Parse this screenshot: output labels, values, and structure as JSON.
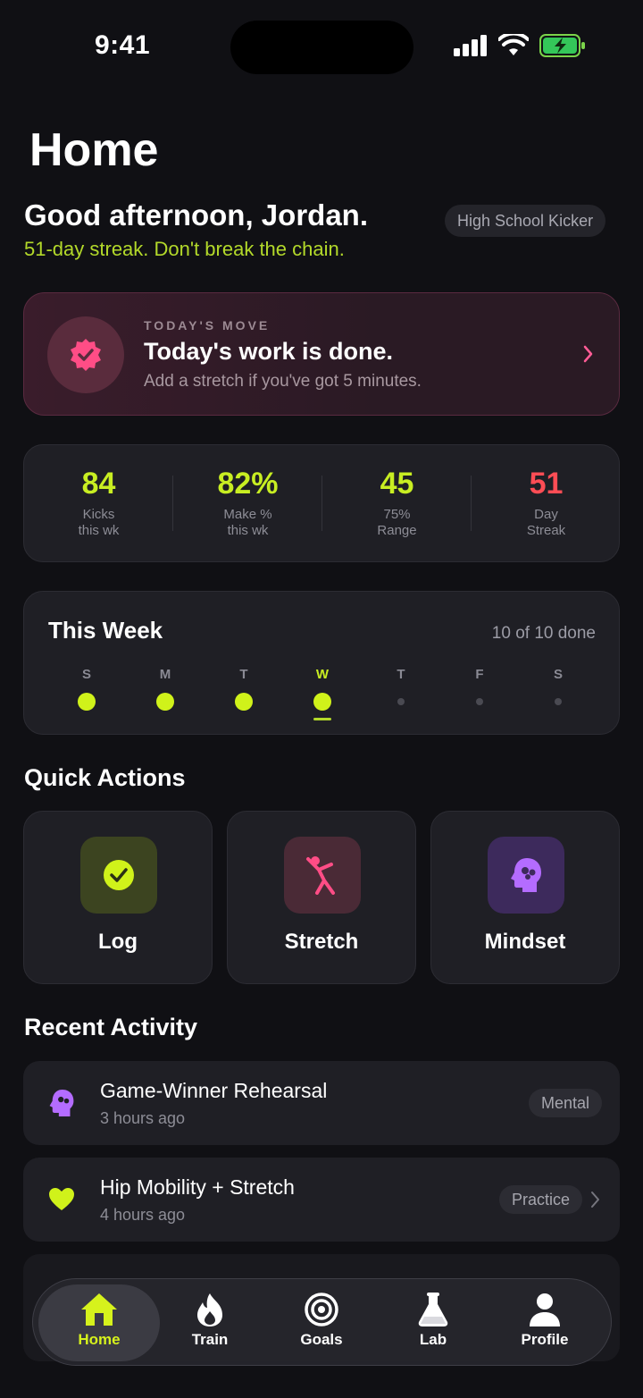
{
  "status_bar": {
    "time": "9:41"
  },
  "page": {
    "title": "Home"
  },
  "greeting": {
    "headline": "Good afternoon, Jordan.",
    "streak_text": "51-day streak. Don't break the chain.",
    "role": "High School Kicker"
  },
  "todays_move": {
    "kicker": "TODAY'S MOVE",
    "title": "Today's work is done.",
    "subtitle": "Add a stretch if you've got 5 minutes."
  },
  "stats": [
    {
      "value": "84",
      "label_1": "Kicks",
      "label_2": "this wk",
      "color": "#c8ee22"
    },
    {
      "value": "82%",
      "label_1": "Make %",
      "label_2": "this wk",
      "color": "#c8ee22"
    },
    {
      "value": "45",
      "label_1": "75%",
      "label_2": "Range",
      "color": "#c8ee22"
    },
    {
      "value": "51",
      "label_1": "Day",
      "label_2": "Streak",
      "color": "#ff4d55"
    }
  ],
  "week": {
    "title": "This Week",
    "count": "10 of 10 done",
    "days": [
      {
        "letter": "S",
        "done": true
      },
      {
        "letter": "M",
        "done": true
      },
      {
        "letter": "T",
        "done": true
      },
      {
        "letter": "W",
        "done": true,
        "today": true
      },
      {
        "letter": "T",
        "done": false
      },
      {
        "letter": "F",
        "done": false
      },
      {
        "letter": "S",
        "done": false
      }
    ]
  },
  "quick_actions": {
    "title": "Quick Actions",
    "items": [
      {
        "label": "Log",
        "icon": "check-circle-icon"
      },
      {
        "label": "Stretch",
        "icon": "stretch-figure-icon"
      },
      {
        "label": "Mindset",
        "icon": "brain-head-icon"
      }
    ]
  },
  "recent": {
    "title": "Recent Activity",
    "items": [
      {
        "title": "Game-Winner Rehearsal",
        "time": "3 hours ago",
        "tag": "Mental",
        "icon": "brain-head-icon"
      },
      {
        "title": "Hip Mobility + Stretch",
        "time": "4 hours ago",
        "tag": "Practice",
        "icon": "heart-icon"
      }
    ]
  },
  "tabs": [
    {
      "label": "Home",
      "icon": "house-icon",
      "active": true
    },
    {
      "label": "Train",
      "icon": "flame-icon"
    },
    {
      "label": "Goals",
      "icon": "target-icon"
    },
    {
      "label": "Lab",
      "icon": "flask-icon"
    },
    {
      "label": "Profile",
      "icon": "person-icon"
    }
  ],
  "colors": {
    "accent": "#c8ee22",
    "streak_red": "#ff4d55",
    "move_pink": "#ff4d86",
    "mindset_purple": "#b46cff"
  }
}
